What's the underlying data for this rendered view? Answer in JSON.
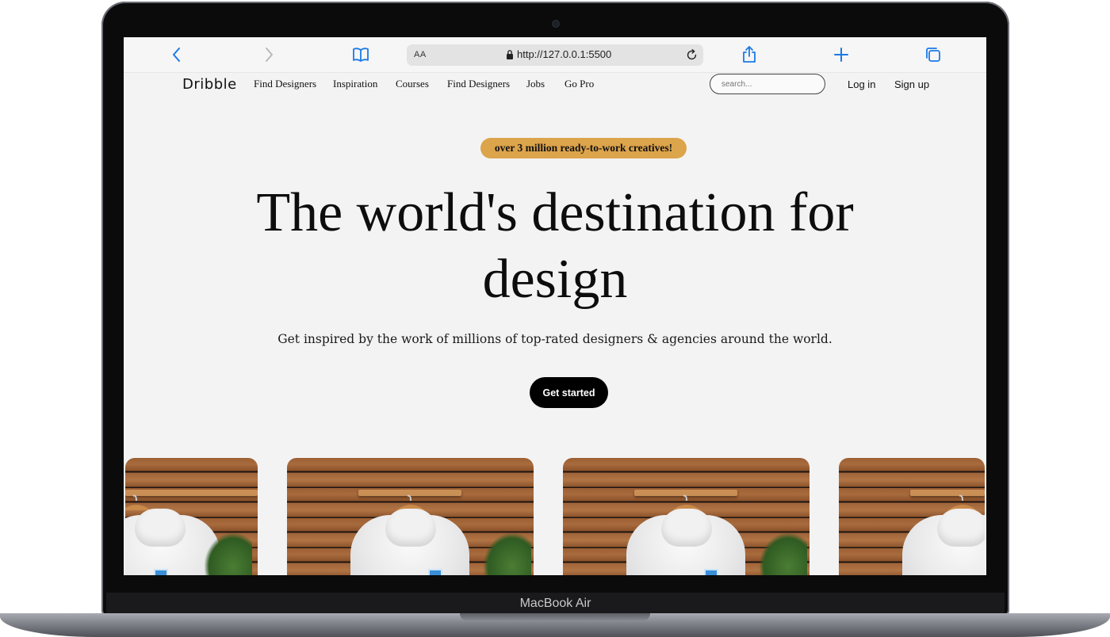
{
  "device": {
    "label": "MacBook Air"
  },
  "browser": {
    "text_size_label": "AA",
    "url": "http://127.0.0.1:5500",
    "icons": [
      "back-chevron-icon",
      "forward-chevron-icon",
      "bookmarks-book-icon",
      "lock-icon",
      "reload-icon",
      "share-icon",
      "new-tab-plus-icon",
      "tabs-overview-icon"
    ]
  },
  "site": {
    "logo": "Dribble",
    "nav": [
      "Find Designers",
      "Inspiration",
      "Courses",
      "Find Designers",
      "Jobs",
      "Go Pro"
    ],
    "search_placeholder": "search...",
    "login": "Log in",
    "signup": "Sign up"
  },
  "hero": {
    "badge": "over 3 million ready-to-work creatives!",
    "headline": "The world's destination for design",
    "subtitle": "Get inspired by the work of millions of top-rated designers & agencies around the world.",
    "cta": "Get started"
  },
  "colors": {
    "badge_bg": "#dca44b",
    "cta_bg": "#000000",
    "accent_blue": "#1a7ae6"
  }
}
